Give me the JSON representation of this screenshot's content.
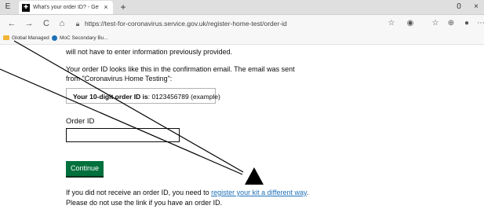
{
  "browser": {
    "tab": {
      "title": "What's your order ID? - Get a co",
      "favicon_label": "GOV",
      "close_label": "×"
    },
    "new_tab_label": "+",
    "window_controls": {
      "minimize": "0",
      "close": "×"
    },
    "nav": {
      "back": "←",
      "forward": "→",
      "refresh": "C",
      "home": "⌂"
    },
    "url": "https://test-for-coronavirus.service.gov.uk/register-home-test/order-id",
    "favorites": [
      {
        "label": "Global Managed",
        "icon": "folder-icon"
      },
      {
        "label": "MoC Secondary Bu...",
        "icon": "page-icon"
      }
    ]
  },
  "page": {
    "intro_text": "will not have to enter information previously provided.",
    "confirmation_line1": "Your order ID looks like this in the confirmation email. The email was sent",
    "confirmation_line2": "from \"Coronavirus Home Testing\":",
    "example": {
      "label": "Your 10-digit order ID is",
      "value": ": 0123456789 (example)"
    },
    "field_label": "Order ID",
    "input_value": "",
    "continue_label": "Continue",
    "help": {
      "prefix": "If you did not receive an order ID, you need to ",
      "link": "register your kit a different way",
      "suffix": ".",
      "line2": "Please do not use the link if you have an order ID."
    }
  }
}
